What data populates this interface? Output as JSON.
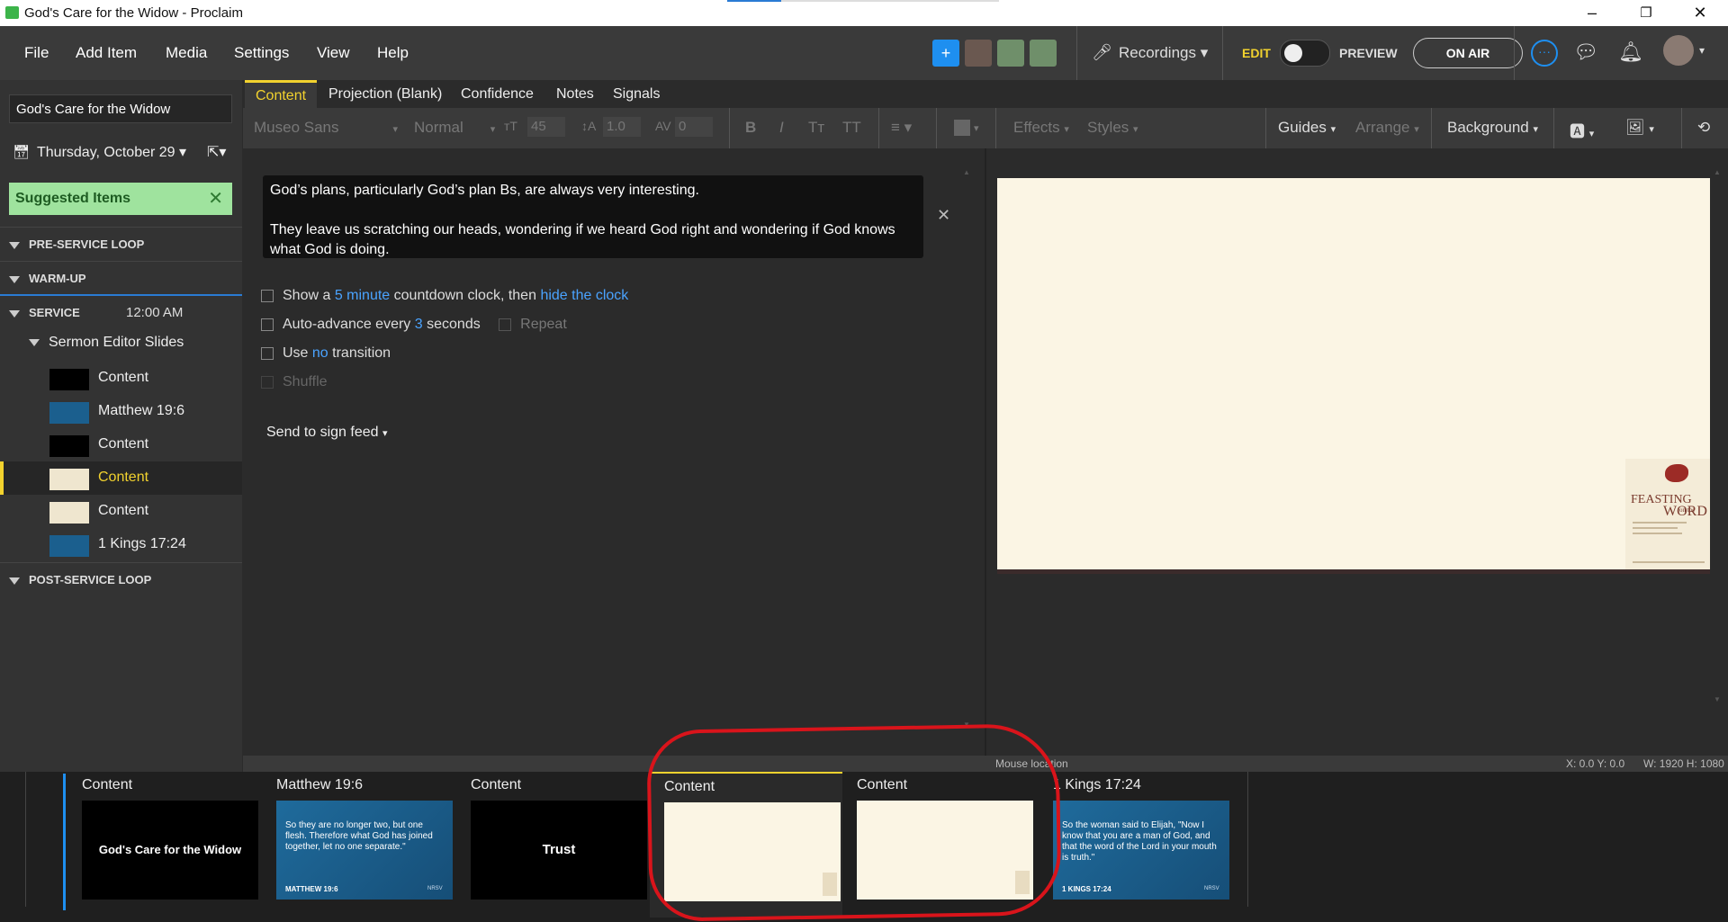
{
  "window": {
    "title": "God's Care for the Widow - Proclaim"
  },
  "menu": {
    "items": [
      "File",
      "Add Item",
      "Media",
      "Settings",
      "View",
      "Help"
    ]
  },
  "header": {
    "recordings": "Recordings",
    "edit_label": "EDIT",
    "preview_label": "PREVIEW",
    "on_air_label": "ON AIR"
  },
  "sidebar": {
    "service_title": "God's Care for the Widow",
    "date": "Thursday, October 29",
    "suggested": "Suggested Items",
    "sections": {
      "pre_service": "PRE-SERVICE LOOP",
      "warm_up": "WARM-UP",
      "service": "SERVICE",
      "service_time": "12:00 AM",
      "post_service": "POST-SERVICE LOOP"
    },
    "subsection": "Sermon Editor Slides",
    "items": [
      {
        "label": "Content",
        "thumb": "black"
      },
      {
        "label": "Matthew 19:6",
        "thumb": "blue"
      },
      {
        "label": "Content",
        "thumb": "black"
      },
      {
        "label": "Content",
        "thumb": "cream",
        "active": true
      },
      {
        "label": "Content",
        "thumb": "cream"
      },
      {
        "label": "1 Kings 17:24",
        "thumb": "blue"
      }
    ]
  },
  "tabs": [
    "Content",
    "Projection (Blank)",
    "Confidence",
    "Notes",
    "Signals"
  ],
  "toolbar": {
    "font": "Museo Sans",
    "weight": "Normal",
    "size": "45",
    "line": "1.0",
    "spacing": "0",
    "effects": "Effects",
    "styles": "Styles",
    "guides": "Guides",
    "arrange": "Arrange",
    "background": "Background"
  },
  "editor": {
    "text_line1": "God’s plans, particularly God’s plan Bs, are always very interesting.",
    "text_line2": "They leave us scratching our heads, wondering if we heard God right and wondering if God knows what God is doing.",
    "opt1_a": "Show a",
    "opt1_link1": "5 minute",
    "opt1_b": "countdown clock, then",
    "opt1_link2": "hide the clock",
    "opt2_a": "Auto-advance every",
    "opt2_link": "3",
    "opt2_b": "seconds",
    "opt2_repeat": "Repeat",
    "opt3_a": "Use",
    "opt3_link": "no",
    "opt3_b": "transition",
    "opt4": "Shuffle",
    "send": "Send to sign feed"
  },
  "preview": {
    "logo_title": "FEASTING",
    "logo_sub": "on the",
    "logo_word": "WORD"
  },
  "status": {
    "mouse": "Mouse location",
    "coords": "X: 0.0  Y: 0.0",
    "dims": "W: 1920  H: 1080"
  },
  "filmstrip": [
    {
      "label": "Content",
      "text": "God's Care for the Widow",
      "style": "black"
    },
    {
      "label": "Matthew 19:6",
      "text": "So they are no longer two, but one flesh. Therefore what God has joined together, let no one separate.\"",
      "ref": "MATTHEW 19:6",
      "version": "NRSV",
      "style": "blue"
    },
    {
      "label": "Content",
      "text": "Trust",
      "style": "black"
    },
    {
      "label": "Content",
      "text": "",
      "style": "cream",
      "active": true
    },
    {
      "label": "Content",
      "text": "",
      "style": "cream"
    },
    {
      "label": "1 Kings 17:24",
      "text": "So the woman said to Elijah, \"Now I know that you are a man of God, and that the word of the Lord in your mouth is truth.\"",
      "ref": "1 KINGS 17:24",
      "version": "NRSV",
      "style": "blue"
    }
  ],
  "colors": {
    "accent": "#f2d22e",
    "link": "#4aa3ff",
    "annotation": "#d9141b"
  }
}
